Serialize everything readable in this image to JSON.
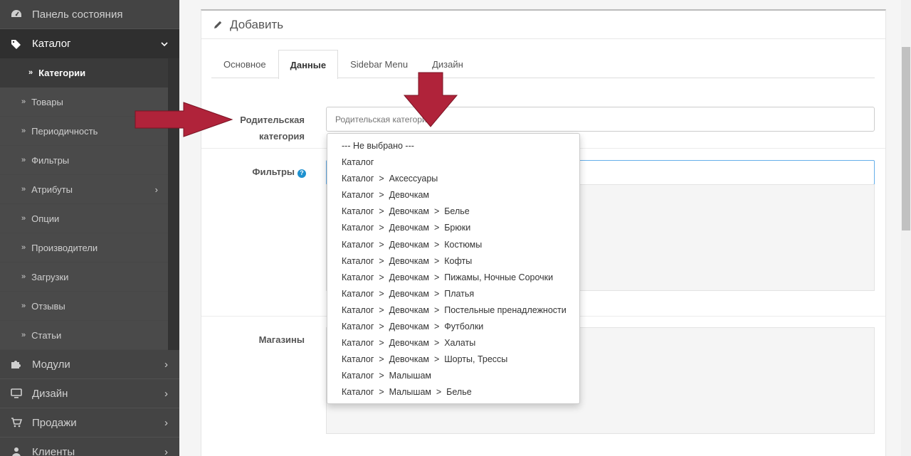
{
  "sidebar": {
    "dashboard": "Панель состояния",
    "catalog": "Каталог",
    "catalog_items": [
      "Категории",
      "Товары",
      "Периодичность",
      "Фильтры",
      "Атрибуты",
      "Опции",
      "Производители",
      "Загрузки",
      "Отзывы",
      "Статьи"
    ],
    "modules": "Модули",
    "design": "Дизайн",
    "sales": "Продажи",
    "clients": "Клиенты"
  },
  "panel": {
    "title": "Добавить"
  },
  "tabs": [
    "Основное",
    "Данные",
    "Sidebar Menu",
    "Дизайн"
  ],
  "form": {
    "parent_label_line1": "Родительская",
    "parent_label_line2": "категория",
    "parent_placeholder": "Родительская категория",
    "filters_label": "Фильтры",
    "stores_label": "Магазины"
  },
  "dropdown_options": [
    "--- Не выбрано ---",
    "Каталог",
    "Каталог  >  Аксессуары",
    "Каталог  >  Девочкам",
    "Каталог  >  Девочкам  >  Белье",
    "Каталог  >  Девочкам  >  Брюки",
    "Каталог  >  Девочкам  >  Костюмы",
    "Каталог  >  Девочкам  >  Кофты",
    "Каталог  >  Девочкам  >  Пижамы, Ночные Сорочки",
    "Каталог  >  Девочкам  >  Платья",
    "Каталог  >  Девочкам  >  Постельные пренадлежности",
    "Каталог  >  Девочкам  >  Футболки",
    "Каталог  >  Девочкам  >  Халаты",
    "Каталог  >  Девочкам  >  Шорты, Трессы",
    "Каталог  >  Малышам",
    "Каталог  >  Малышам  >  Белье"
  ],
  "colors": {
    "sidebar_bg": "#444444",
    "accent_blue": "#1e91cf",
    "arrow_red": "#b0233a"
  },
  "icons": {
    "dashboard": "dashboard-icon",
    "catalog": "tag-icon",
    "modules": "puzzle-icon",
    "design": "monitor-icon",
    "sales": "cart-icon",
    "clients": "user-icon",
    "heading": "pencil-icon"
  }
}
